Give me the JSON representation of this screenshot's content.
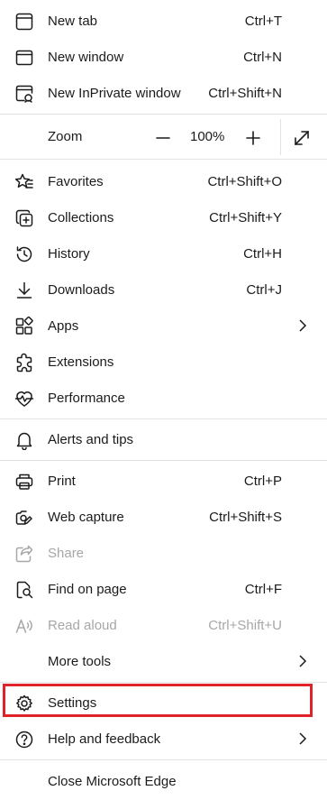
{
  "menu": {
    "new_tab": {
      "label": "New tab",
      "shortcut": "Ctrl+T"
    },
    "new_window": {
      "label": "New window",
      "shortcut": "Ctrl+N"
    },
    "new_inprivate": {
      "label": "New InPrivate window",
      "shortcut": "Ctrl+Shift+N"
    },
    "zoom": {
      "label": "Zoom",
      "value": "100%"
    },
    "favorites": {
      "label": "Favorites",
      "shortcut": "Ctrl+Shift+O"
    },
    "collections": {
      "label": "Collections",
      "shortcut": "Ctrl+Shift+Y"
    },
    "history": {
      "label": "History",
      "shortcut": "Ctrl+H"
    },
    "downloads": {
      "label": "Downloads",
      "shortcut": "Ctrl+J"
    },
    "apps": {
      "label": "Apps"
    },
    "extensions": {
      "label": "Extensions"
    },
    "performance": {
      "label": "Performance"
    },
    "alerts": {
      "label": "Alerts and tips"
    },
    "print": {
      "label": "Print",
      "shortcut": "Ctrl+P"
    },
    "web_capture": {
      "label": "Web capture",
      "shortcut": "Ctrl+Shift+S"
    },
    "share": {
      "label": "Share"
    },
    "find": {
      "label": "Find on page",
      "shortcut": "Ctrl+F"
    },
    "read_aloud": {
      "label": "Read aloud",
      "shortcut": "Ctrl+Shift+U"
    },
    "more_tools": {
      "label": "More tools"
    },
    "settings": {
      "label": "Settings"
    },
    "help": {
      "label": "Help and feedback"
    },
    "close": {
      "label": "Close Microsoft Edge"
    }
  },
  "colors": {
    "highlight": "#e0232b",
    "disabled_text": "#a7a7a7",
    "separator": "#e3e3e3"
  }
}
